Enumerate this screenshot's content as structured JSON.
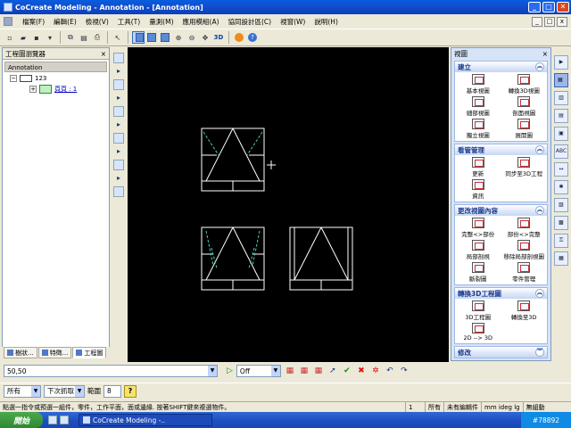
{
  "window": {
    "title": "CoCreate Modeling - Annotation - [Annotation]",
    "min": "_",
    "max": "□",
    "close": "✕"
  },
  "menu": {
    "items": [
      "檔案(F)",
      "編輯(E)",
      "檢視(V)",
      "工具(T)",
      "量測(M)",
      "應用模組(A)",
      "協同設計區(C)",
      "視窗(W)",
      "說明(H)"
    ],
    "mdi_buttons": [
      "_",
      "□",
      "x"
    ]
  },
  "toolbar": {
    "icons": [
      "new-icon",
      "open-icon",
      "save-icon",
      "save-dropdown-icon",
      "sep",
      "copy-icon",
      "paste-icon",
      "print-icon",
      "sep",
      "select-icon",
      "sep",
      "zoom-fit-icon",
      "zoom-all-icon",
      "zoom-window-icon",
      "zoom-in-icon",
      "zoom-out-icon",
      "pan-icon",
      "3d-icon",
      "sep",
      "stop-icon",
      "help-icon"
    ],
    "label_3d": "3D"
  },
  "browser": {
    "title": "工程圖瀏覽器",
    "close": "×",
    "subheader": "Annotation",
    "tree": {
      "root": "123",
      "child": "頁頁 : 1"
    },
    "tabs": [
      "樹狀...",
      "特徵...",
      "工程圖"
    ]
  },
  "right_panel": {
    "title": "視圖",
    "sections": [
      {
        "title": "建立",
        "items": [
          "基本視圖",
          "轉換3D視圖",
          "細部視圖",
          "剖面視圖",
          "獨立視圖",
          "展開圖"
        ]
      },
      {
        "title": "看管管理",
        "items": [
          "更新",
          "同步至3D工程",
          "資訊"
        ]
      },
      {
        "title": "更改視圖內容",
        "items": [
          "完整<>部份",
          "部份<>完整",
          "局部剖視",
          "移除局部剖視圖",
          "斷裂圖",
          "零件管理"
        ]
      },
      {
        "title": "轉換3D工程圖",
        "items": [
          "3D工程圖",
          "轉換至3D",
          "2D --> 3D"
        ]
      },
      {
        "title": "修改"
      }
    ]
  },
  "right_strip": [
    "play-icon",
    "panel-icon",
    "layout-icon",
    "sheet-icon",
    "frame-icon",
    "abc-icon",
    "dim-icon",
    "symbol-icon",
    "hatch-icon",
    "grid-icon",
    "lock-icon",
    "table-icon"
  ],
  "bottom": {
    "coord_value": "50,50",
    "snap_value": "Off",
    "filter1": "所有",
    "filter2": "下次抓取",
    "range_label": "範圍",
    "range_value": "8",
    "help_button": "?"
  },
  "status": {
    "message": "點選一指令或預選一組件，零件，工作平面，面或邊緣. 按著SHIFT鍵來複選物件。",
    "page": "1",
    "filter": "所有",
    "part": "未有編輯件",
    "units": "mm ideg lg",
    "group": "無組動"
  },
  "taskbar": {
    "start": "開始",
    "task": "CoCreate Modeling -..",
    "tray": "#78892"
  },
  "colors": {
    "canvas_bg": "#000000",
    "geometry": "#ffffff",
    "hidden_lines": "#4fc9b8"
  }
}
